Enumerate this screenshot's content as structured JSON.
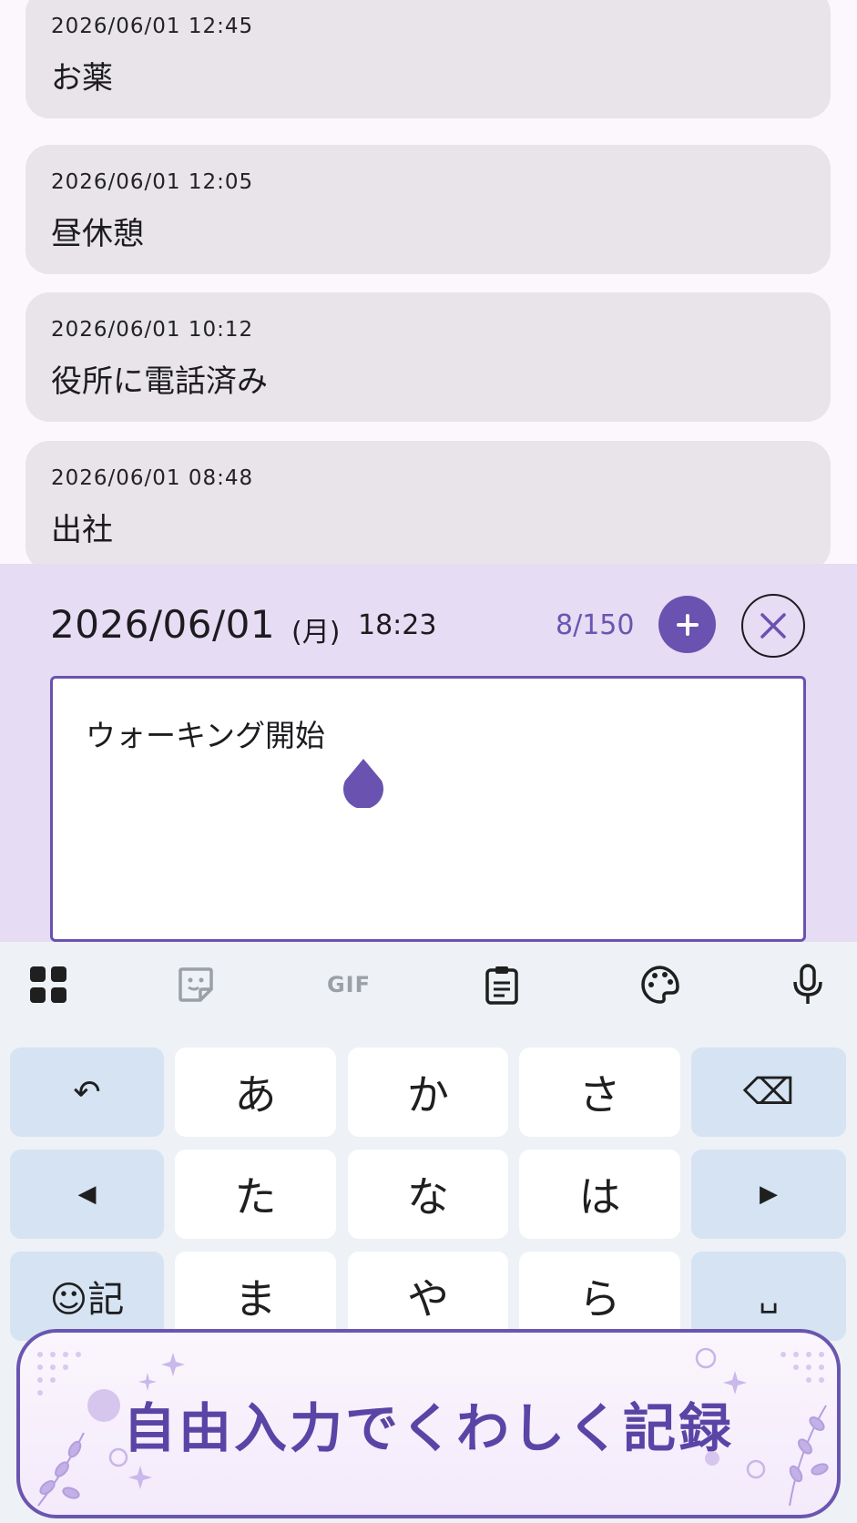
{
  "entries": [
    {
      "timestamp": "2026/06/01 12:45",
      "text": "お薬"
    },
    {
      "timestamp": "2026/06/01 12:05",
      "text": "昼休憩"
    },
    {
      "timestamp": "2026/06/01 10:12",
      "text": "役所に電話済み"
    },
    {
      "timestamp": "2026/06/01 08:48",
      "text": "出社"
    }
  ],
  "editor": {
    "date": "2026/06/01",
    "day_of_week": "(月)",
    "time": "18:23",
    "char_count": "8/150",
    "input_value": "ウォーキング開始"
  },
  "keyboard": {
    "toolbar": {
      "gif_label": "GIF"
    },
    "rows": [
      [
        "↶",
        "あ",
        "か",
        "さ",
        "⌫"
      ],
      [
        "◀",
        "た",
        "な",
        "は",
        "▶"
      ],
      [
        "☺記",
        "ま",
        "や",
        "ら",
        "␣"
      ]
    ]
  },
  "banner": {
    "text": "自由入力でくわしく記録"
  },
  "colors": {
    "accent": "#6952b0",
    "card_bg": "#e8e4ea",
    "editor_bg": "#e6dcf3",
    "key_fn_bg": "#d5e3f3"
  }
}
